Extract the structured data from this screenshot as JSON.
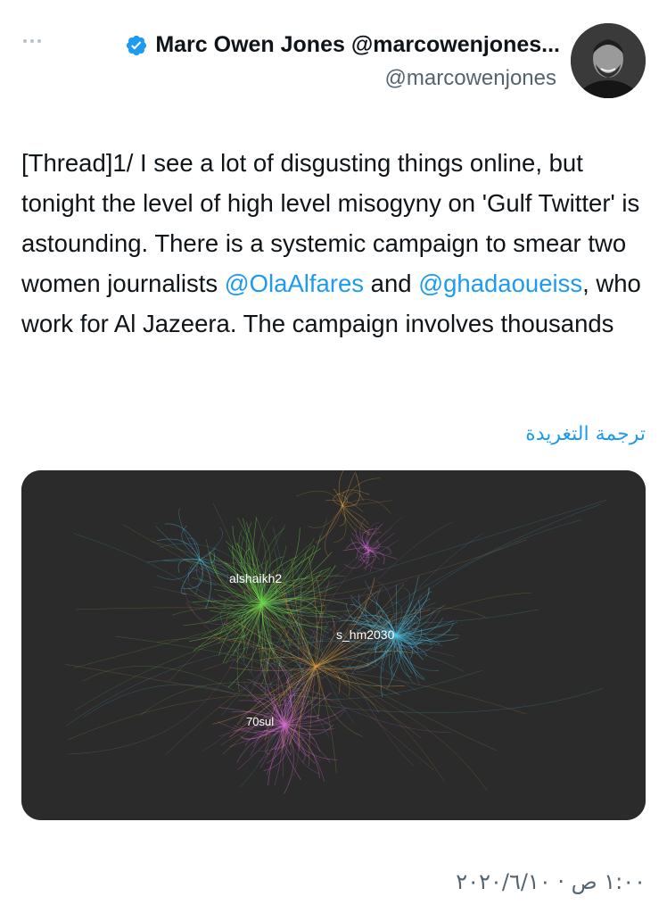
{
  "tweet": {
    "author_name": "Marc Owen Jones @marcowenjones...",
    "handle": "@marcowenjones",
    "text_part1": "[Thread]1/ I see a lot of disgusting things online, but tonight the level of high level misogyny on 'Gulf Twitter' is astounding. There is a systemic campaign to smear two women journalists ",
    "mention1": "@OlaAlfares",
    "text_and": " and ",
    "mention2": "@ghadaoueiss",
    "text_part2": ", who work for Al Jazeera. The campaign involves thousands",
    "translate_label": "ترجمة التغريدة",
    "timestamp": "١:٠٠ ص · ٢٠٢٠/٦/١٠"
  },
  "icons": {
    "more": "more-options-icon",
    "verified": "verified-badge-icon",
    "verified_color": "#1d9bf0"
  },
  "graph": {
    "labels": {
      "alshaikh2": "alshaikh2",
      "s_hm2030": "s_hm2030",
      "70sul": "70sul"
    },
    "colors": {
      "background": "#2b2b2b",
      "green": "#6cd94a",
      "cyan": "#4cc3e8",
      "magenta": "#d86ad8",
      "orange": "#e0a040"
    }
  }
}
